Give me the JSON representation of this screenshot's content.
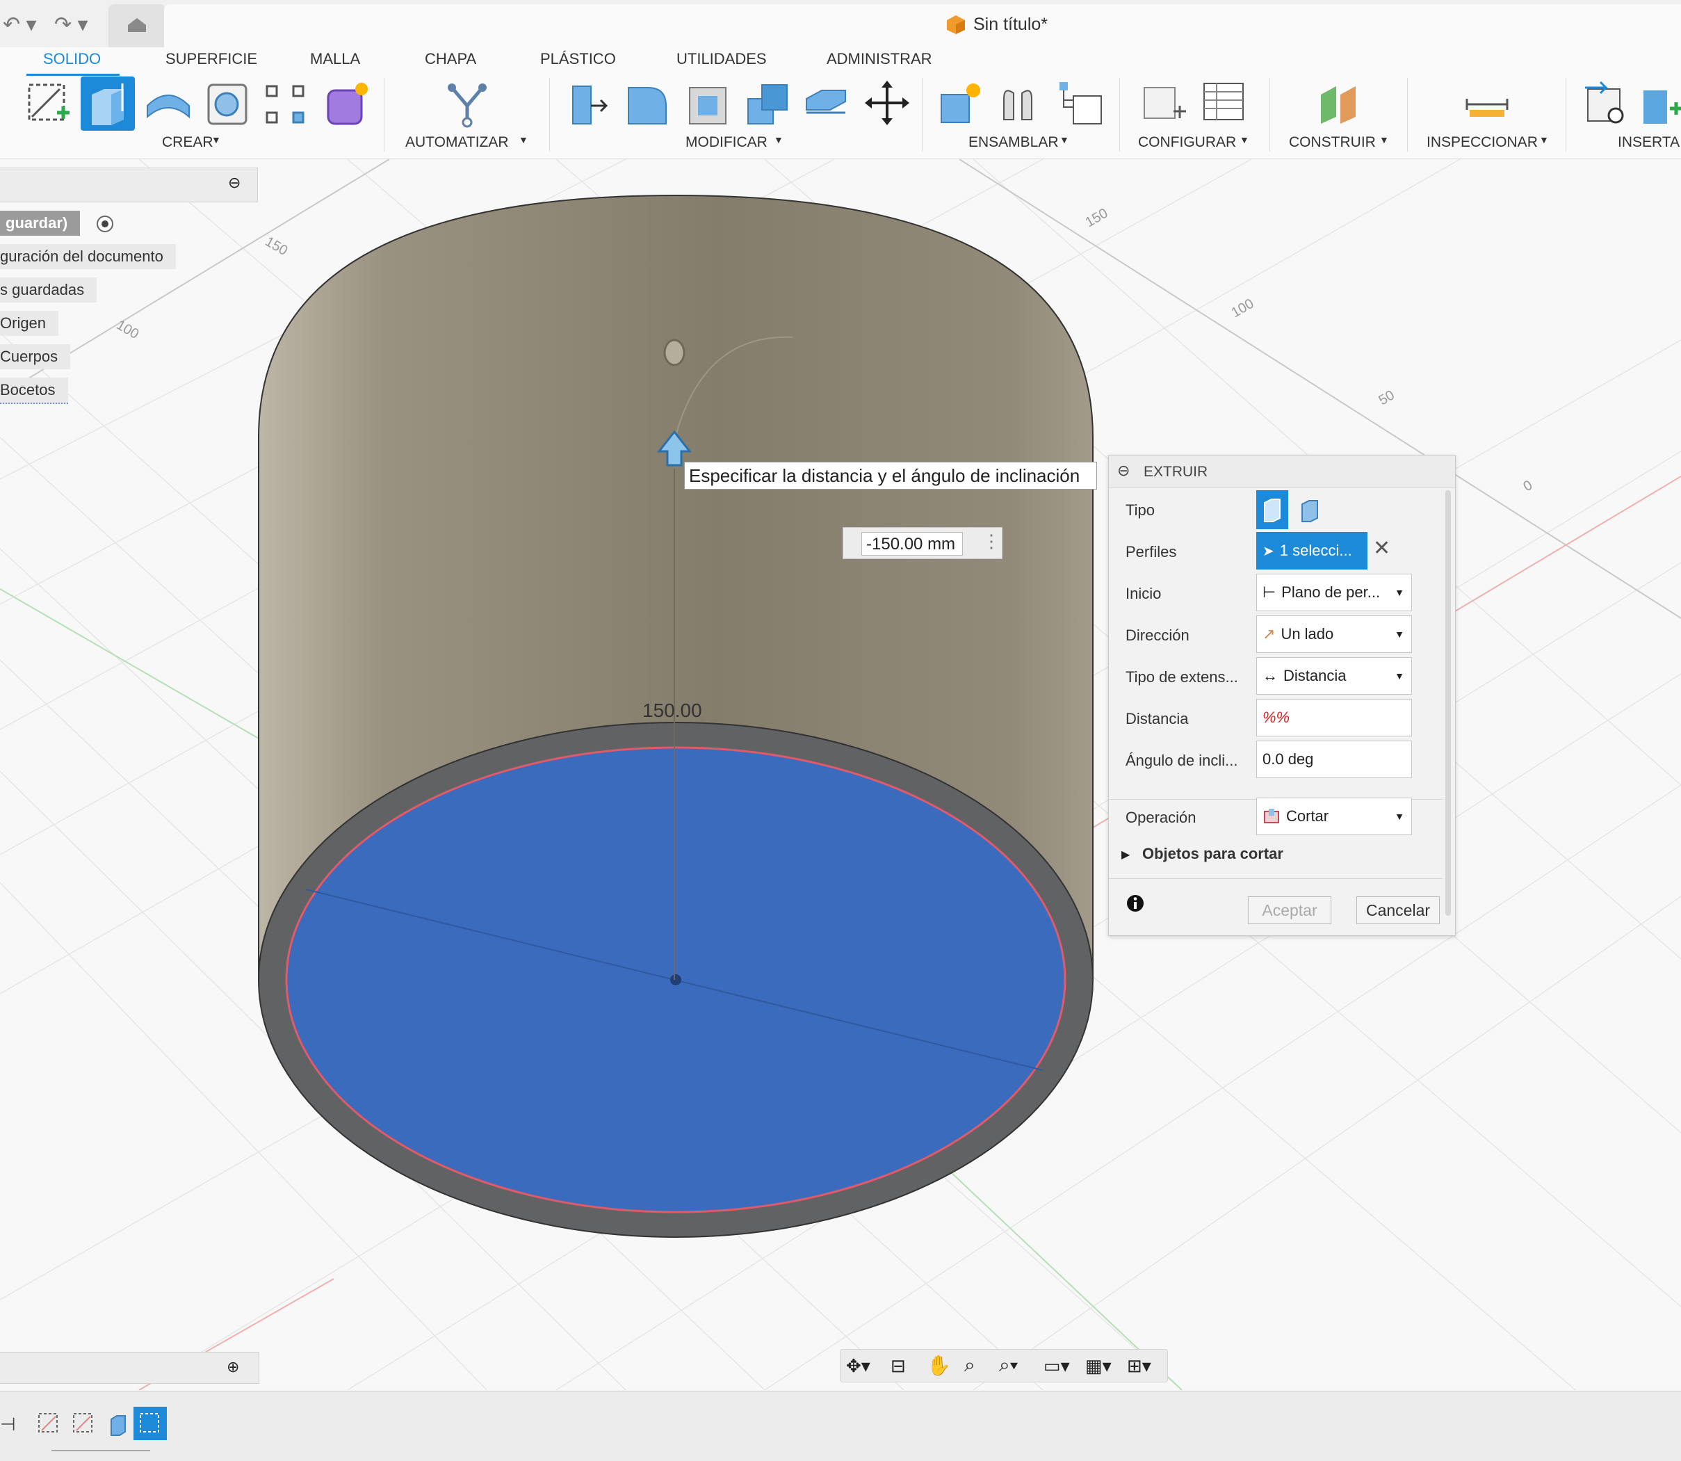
{
  "quick_access": {
    "undo_icon": "undo-icon",
    "redo_icon": "redo-icon",
    "home_icon": "home-icon"
  },
  "document": {
    "title": "Sin título*",
    "icon": "cube-icon"
  },
  "ribbon": {
    "tabs": [
      "SOLIDO",
      "SUPERFICIE",
      "MALLA",
      "CHAPA",
      "PLÁSTICO",
      "UTILIDADES",
      "ADMINISTRAR"
    ],
    "active_tab": "SOLIDO",
    "groups": [
      "CREAR",
      "AUTOMATIZAR",
      "MODIFICAR",
      "ENSAMBLAR",
      "CONFIGURAR",
      "CONSTRUIR",
      "INSPECCIONAR",
      "INSERTA"
    ]
  },
  "browser": {
    "items": [
      "guardar)",
      "guración del documento",
      "s guardadas",
      "Origen",
      "Cuerpos",
      "Bocetos"
    ]
  },
  "grid_labels": [
    "150",
    "100",
    "150",
    "100",
    "50",
    "0"
  ],
  "viewport": {
    "tooltip": "Especificar la distancia y el ángulo de inclinación",
    "inline_distance": "-150.00 mm",
    "dimension_label": "150.00"
  },
  "extrude": {
    "title": "EXTRUIR",
    "rows": {
      "tipo": "Tipo",
      "perfiles": "Perfiles",
      "perfiles_value": "1 selecci...",
      "inicio": "Inicio",
      "inicio_value": "Plano de per...",
      "direccion": "Dirección",
      "direccion_value": "Un lado",
      "tipo_extension": "Tipo de extens...",
      "tipo_extension_value": "Distancia",
      "distancia": "Distancia",
      "distancia_value": "%%",
      "angulo": "Ángulo de incli...",
      "angulo_value": "0.0 deg",
      "operacion": "Operación",
      "operacion_value": "Cortar",
      "objetos": "Objetos para cortar"
    },
    "accept": "Aceptar",
    "cancel": "Cancelar"
  },
  "colors": {
    "accent": "#1c8ad8",
    "body": "#8c8473",
    "profile": "#3a6bbd",
    "rim": "#616263"
  }
}
